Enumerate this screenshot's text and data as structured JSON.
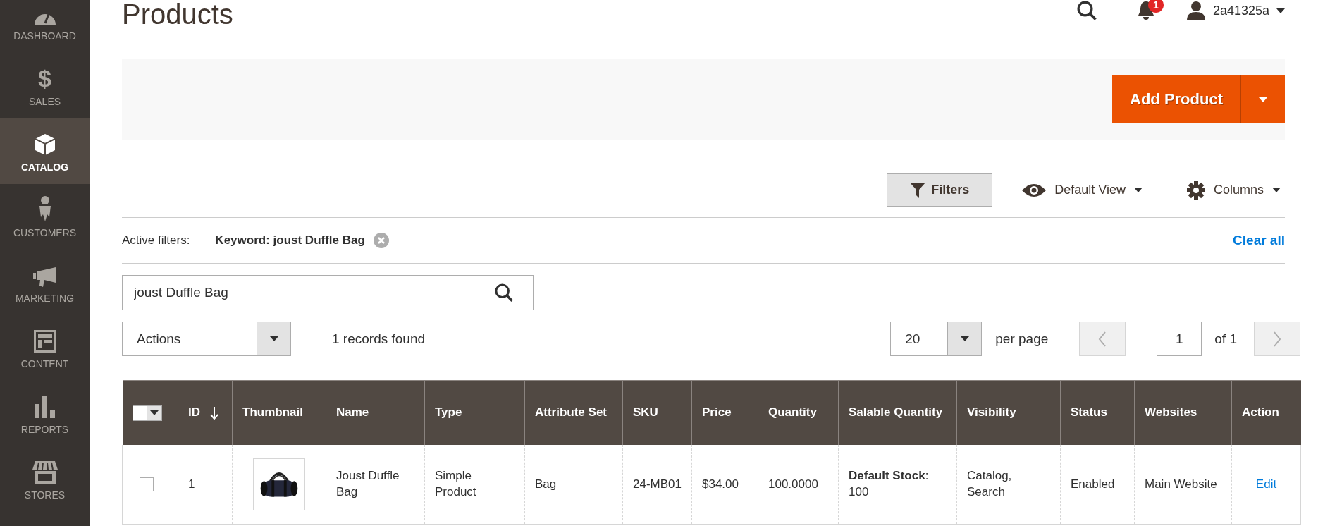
{
  "sidebar": {
    "items": [
      {
        "kind": "dashboard",
        "label": "DASHBOARD",
        "selected": false
      },
      {
        "kind": "sales",
        "icon_char": "$",
        "label": "SALES",
        "selected": false
      },
      {
        "kind": "catalog",
        "label": "CATALOG",
        "selected": true
      },
      {
        "kind": "customers",
        "label": "CUSTOMERS",
        "selected": false
      },
      {
        "kind": "marketing",
        "label": "MARKETING",
        "selected": false
      },
      {
        "kind": "content",
        "label": "CONTENT",
        "selected": false
      },
      {
        "kind": "reports",
        "label": "REPORTS",
        "selected": false
      },
      {
        "kind": "stores",
        "label": "STORES",
        "selected": false
      }
    ]
  },
  "page_title": "Products",
  "header": {
    "notification_count": "1",
    "user": "2a41325a"
  },
  "page_actions": {
    "add_button": "Add Product"
  },
  "toolbar": {
    "filters_button": "Filters",
    "view": "Default View",
    "columns": "Columns"
  },
  "active_filters": {
    "label": "Active filters:",
    "filters": [
      "Keyword: joust Duffle Bag"
    ],
    "clear_all": "Clear all"
  },
  "search": {
    "value": "joust Duffle Bag"
  },
  "actions_select": "Actions",
  "records_found": "1 records found",
  "pagination": {
    "page_size": "20",
    "per_page_label": "per page",
    "page": "1",
    "of_label": "of 1"
  },
  "table": {
    "select_all_checked": false,
    "columns": [
      {
        "label": "ID",
        "sorted": true
      },
      {
        "label": "Thumbnail",
        "sorted": false
      },
      {
        "label": "Name",
        "sorted": false
      },
      {
        "label": "Type",
        "sorted": false
      },
      {
        "label": "Attribute Set",
        "sorted": false
      },
      {
        "label": "SKU",
        "sorted": false
      },
      {
        "label": "Price",
        "sorted": false
      },
      {
        "label": "Quantity",
        "sorted": false
      },
      {
        "label": "Salable Quantity",
        "sorted": false
      },
      {
        "label": "Visibility",
        "sorted": false
      },
      {
        "label": "Status",
        "sorted": false
      },
      {
        "label": "Websites",
        "sorted": false
      },
      {
        "label": "Action",
        "sorted": false
      }
    ],
    "rows": [
      {
        "checked": false,
        "cells": [
          {
            "kind": "text",
            "text": "1"
          },
          {
            "kind": "picture"
          },
          {
            "kind": "text",
            "text": "Joust Duffle Bag"
          },
          {
            "kind": "text",
            "text": "Simple Product"
          },
          {
            "kind": "text",
            "text": "Bag"
          },
          {
            "kind": "text",
            "text": "24-MB01"
          },
          {
            "kind": "text",
            "text": "$34.00"
          },
          {
            "kind": "text",
            "text": "100.0000"
          },
          {
            "kind": "rich",
            "text": "**Default Stock**: 100"
          },
          {
            "kind": "text",
            "text": "Catalog, Search"
          },
          {
            "kind": "text",
            "text": "Enabled"
          },
          {
            "kind": "text",
            "text": "Main Website"
          },
          {
            "kind": "link",
            "text": "Edit"
          }
        ]
      }
    ]
  }
}
